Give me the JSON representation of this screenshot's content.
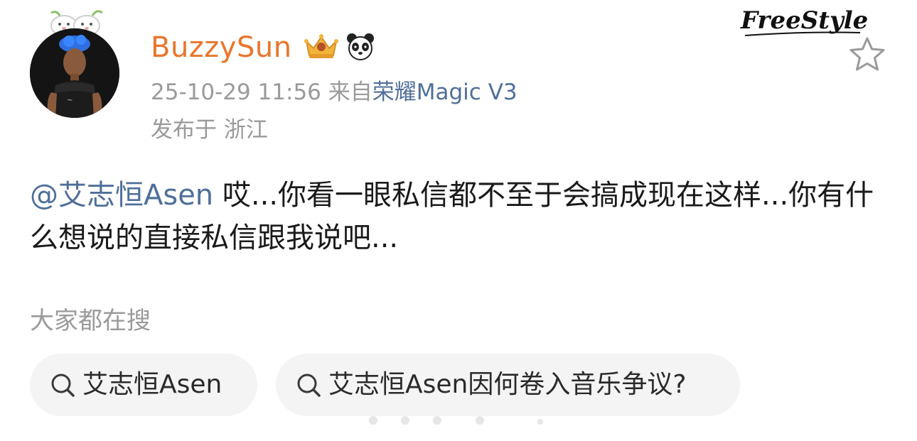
{
  "header": {
    "username": "BuzzySun",
    "timestamp": "25-10-29 11:56",
    "source_prefix": "来自",
    "source_device": "荣耀Magic V3",
    "location": "发布于 浙江",
    "watermark": "FreeStyle"
  },
  "post": {
    "mention": "@艾志恒Asen",
    "text": " 哎...你看一眼私信都不至于会搞成现在这样...你有什么想说的直接私信跟我说吧..."
  },
  "trending": {
    "title": "大家都在搜",
    "chips": [
      {
        "label": "艾志恒Asen"
      },
      {
        "label": "艾志恒Asen因何卷入音乐争议?"
      }
    ]
  },
  "icons": {
    "favorite": "star-outline-icon",
    "search": "search-icon",
    "crown_badge": "crown-badge-icon",
    "panda_badge": "panda-icon"
  },
  "colors": {
    "username": "#e8762c",
    "link": "#4f6f9a",
    "meta": "#9a9a9a",
    "chip_bg": "#f4f4f4"
  }
}
